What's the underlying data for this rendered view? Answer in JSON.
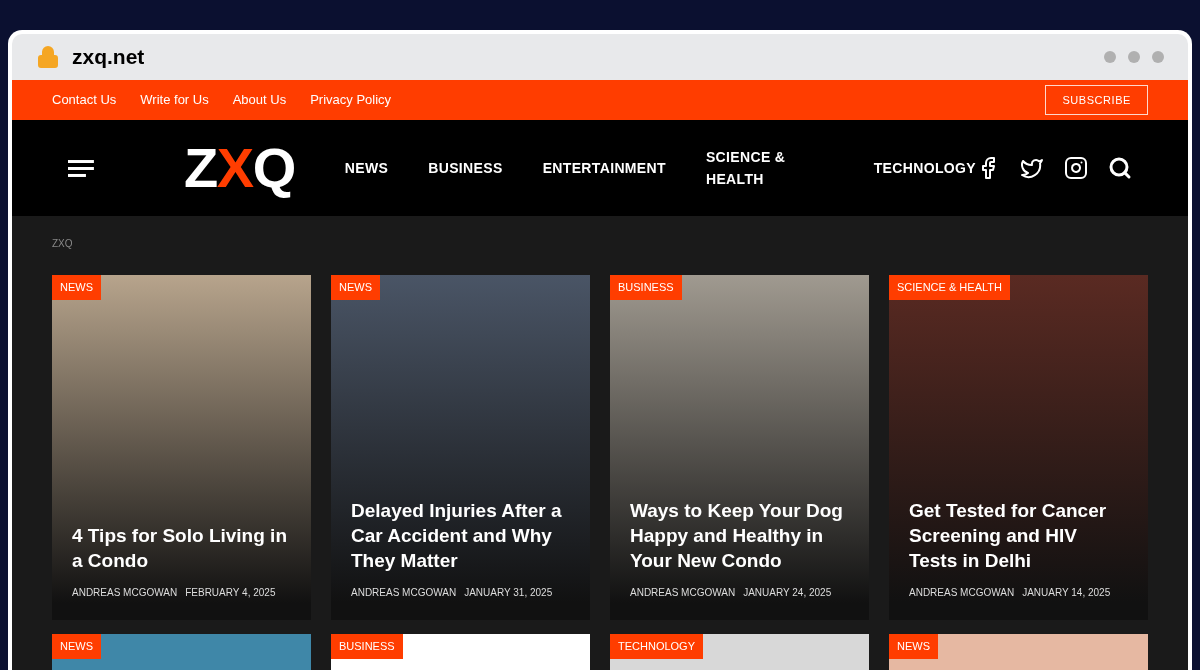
{
  "browser": {
    "url": "zxq.net"
  },
  "top_links": [
    "Contact Us",
    "Write for Us",
    "About Us",
    "Privacy Policy"
  ],
  "subscribe": "SUBSCRIBE",
  "nav": {
    "logo": [
      "Z",
      "X",
      "Q"
    ],
    "items": [
      {
        "label": "NEWS"
      },
      {
        "label": "BUSINESS"
      },
      {
        "label": "ENTERTAINMENT"
      },
      {
        "label": "SCIENCE & HEALTH"
      },
      {
        "label": "TECHNOLOGY"
      }
    ]
  },
  "breadcrumb": "ZXQ",
  "featured": [
    {
      "tag": "NEWS",
      "title": "4 Tips for Solo Living in a Condo",
      "author": "ANDREAS MCGOWAN",
      "date": "FEBRUARY 4, 2025",
      "color": "#b7a48c"
    },
    {
      "tag": "NEWS",
      "title": "Delayed Injuries After a Car Accident and Why They Matter",
      "author": "ANDREAS MCGOWAN",
      "date": "JANUARY 31, 2025",
      "color": "#4a5566"
    },
    {
      "tag": "BUSINESS",
      "title": "Ways to Keep Your Dog Happy and Healthy in Your New Condo",
      "author": "ANDREAS MCGOWAN",
      "date": "JANUARY 24, 2025",
      "color": "#a09a90"
    },
    {
      "tag": "SCIENCE & HEALTH",
      "title": "Get Tested for Cancer Screening and HIV Tests in Delhi",
      "author": "ANDREAS MCGOWAN",
      "date": "JANUARY 14, 2025",
      "color": "#5a2a22"
    }
  ],
  "more": [
    {
      "tag": "NEWS",
      "color": "#3f87a8"
    },
    {
      "tag": "BUSINESS",
      "color": "#ffffff"
    },
    {
      "tag": "TECHNOLOGY",
      "color": "#d8d8d8"
    },
    {
      "tag": "NEWS",
      "color": "#e6b8a2"
    }
  ]
}
